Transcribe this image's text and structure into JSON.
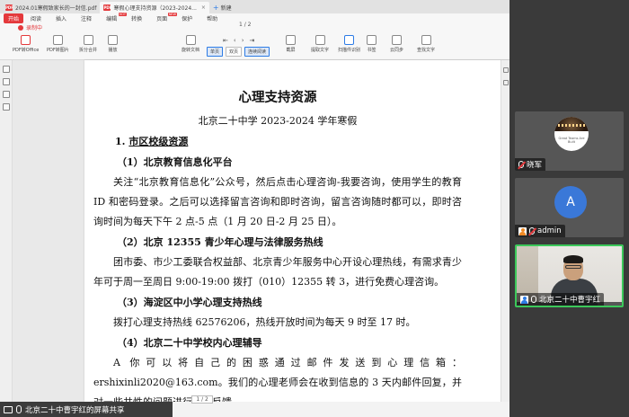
{
  "tabs": [
    {
      "label": "2024.01寒假致家长的一封信.pdf",
      "active": false
    },
    {
      "label": "寒假心理支持资源（2023-2024...",
      "active": true
    }
  ],
  "new_tab_label": "新建",
  "menu": {
    "items": [
      "开始",
      "阅读",
      "插入",
      "注释",
      "编辑",
      "转换",
      "页面",
      "保护",
      "帮助"
    ],
    "hot_index": 4,
    "new_index": 6,
    "recording_label": "录制中",
    "page_indicator": "1 / 2"
  },
  "toolbar": {
    "pdf_to_office": "PDF转Office",
    "pdf_to_image": "PDF转图片",
    "split_merge": "拆分合并",
    "play": "播放",
    "rotate_doc": "旋转文档",
    "single_page": "单页",
    "dual_page": "双页",
    "continuous": "连续阅读",
    "ocr": "截屏",
    "extract_text": "提取文字",
    "scan_recognize": "扫描件识别",
    "bookmark": "书签",
    "cloud": "云同步",
    "find_replace": "查找文字"
  },
  "document": {
    "title": "心理支持资源",
    "subtitle": "北京二十中学 2023-2024 学年寒假",
    "section1_num": "1.",
    "section1_title": "市区校级资源",
    "s1_title": "（1）北京教育信息化平台",
    "s1_body": "关注“北京教育信息化”公众号，然后点击心理咨询-我要咨询，使用学生的教育 ID 和密码登录。之后可以选择留言咨询和即时咨询，留言咨询随时都可以，即时咨询时间为每天下午 2 点-5 点（1 月 20 日-2 月 25 日）。",
    "s2_title": "（2）北京 12355 青少年心理与法律服务热线",
    "s2_body": "团市委、市少工委联合权益部、北京青少年服务中心开设心理热线，有需求青少年可于周一至周日 9:00-19:00 拨打（010）12355 转 3，进行免费心理咨询。",
    "s3_title": "（3）海淀区中小学心理支持热线",
    "s3_body": "拨打心理支持热线 62576206，热线开放时间为每天 9 时至 17 时。",
    "s4_title": "（4）北京二十中学校内心理辅导",
    "s4_body": "A 你可以将自己的困惑通过邮件发送到心理信箱：ershixinli2020@163.com。我们的心理老师会在收到信息的 3 天内邮件回复，并对一些共性的问题进行集中反馈。"
  },
  "status": {
    "page_box": "1 / 2"
  },
  "share_bar": {
    "label": "北京二十中曹宇红的屏幕共享"
  },
  "participants": [
    {
      "name": "晓军",
      "avatar_type": "logo",
      "logo_caption": "Great Teams Are Built",
      "mic_muted": true
    },
    {
      "name": "admin",
      "avatar_type": "initial",
      "initial": "A",
      "mic_muted": true
    },
    {
      "name": "北京二十中曹宇红",
      "avatar_type": "camera",
      "mic_muted": false,
      "active_speaker": true
    }
  ],
  "colors": {
    "accent_red": "#e4393c",
    "speaker_green": "#3cc85a",
    "avatar_blue": "#3a78d8"
  }
}
